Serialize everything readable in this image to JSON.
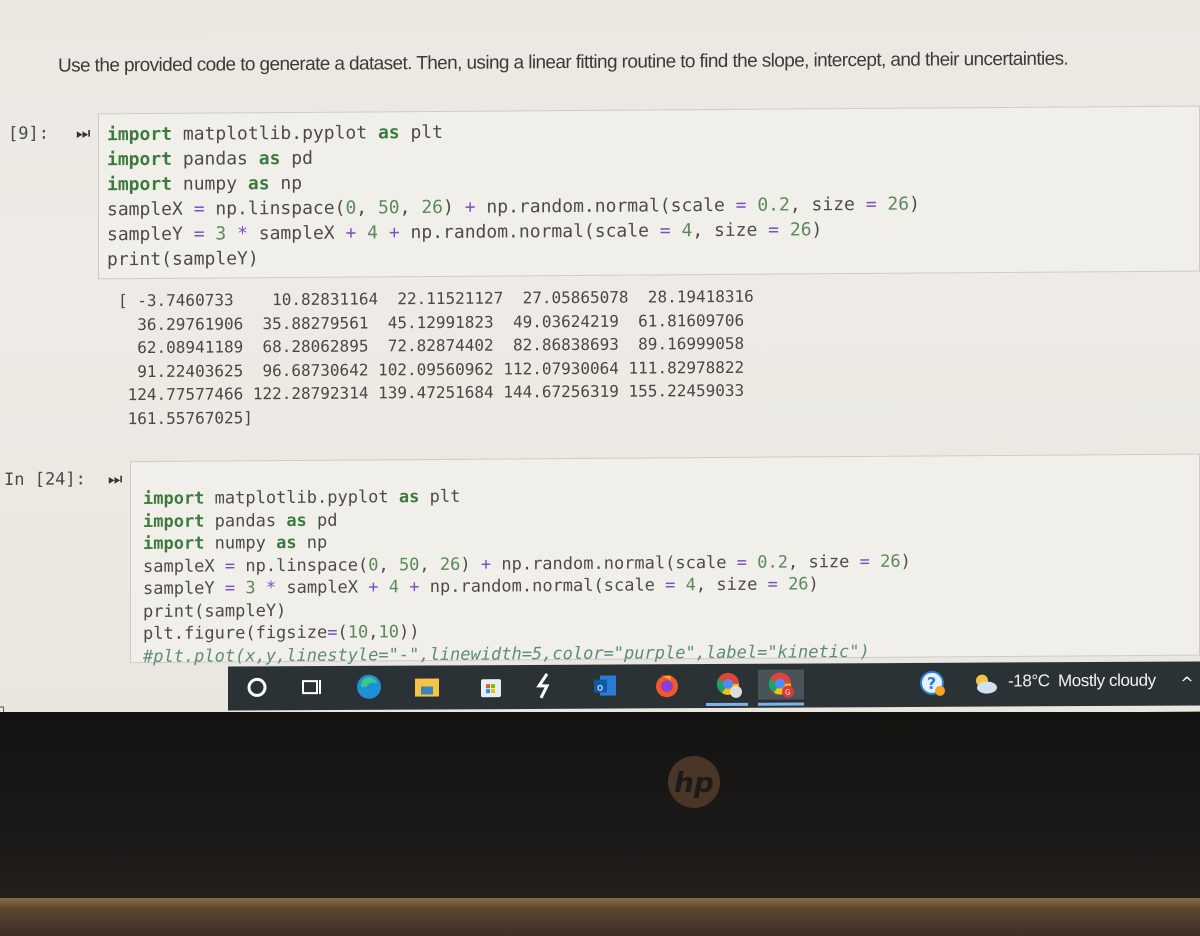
{
  "instruction": "Use the provided code to generate a dataset. Then, using a linear fitting routine to find the slope, intercept, and their uncertainties.",
  "cells": [
    {
      "prompt": "[9]:",
      "code_lines": [
        "import matplotlib.pyplot as plt",
        "import pandas as pd",
        "import numpy as np",
        "sampleX = np.linspace(0, 50, 26) + np.random.normal(scale = 0.2, size = 26)",
        "sampleY = 3 * sampleX + 4 + np.random.normal(scale = 4, size = 26)",
        "print(sampleY)"
      ],
      "output_lines": [
        "[ -3.7460733    10.82831164  22.11521127  27.05865078  28.19418316",
        "  36.29761906  35.88279561  45.12991823  49.03624219  61.81609706",
        "  62.08941189  68.28062895  72.82874402  82.86838693  89.16999058",
        "  91.22403625  96.68730642 102.09560962 112.07930064 111.82978822",
        " 124.77577466 122.28792314 139.47251684 144.67256319 155.22459033",
        " 161.55767025]"
      ]
    },
    {
      "prompt": "In [24]:",
      "code_lines": [
        "import matplotlib.pyplot as plt",
        "import pandas as pd",
        "import numpy as np",
        "sampleX = np.linspace(0, 50, 26) + np.random.normal(scale = 0.2, size = 26)",
        "sampleY = 3 * sampleX + 4 + np.random.normal(scale = 4, size = 26)",
        "print(sampleY)",
        "plt.figure(figsize=(10,10))",
        "#plt.plot(x,y,linestyle=\"-\",linewidth=5,color=\"purple\",label=\"kinetic\")"
      ]
    }
  ],
  "taskbar": {
    "icons": [
      "search-circle",
      "task-view",
      "edge",
      "file-explorer",
      "microsoft-store",
      "winamp-bolt",
      "outlook",
      "firefox",
      "chrome-profile",
      "chrome-g",
      "help"
    ],
    "weather": {
      "temperature": "-18°C",
      "condition": "Mostly cloudy"
    },
    "chevron": "^"
  },
  "bezel": {
    "brand": "hp"
  }
}
